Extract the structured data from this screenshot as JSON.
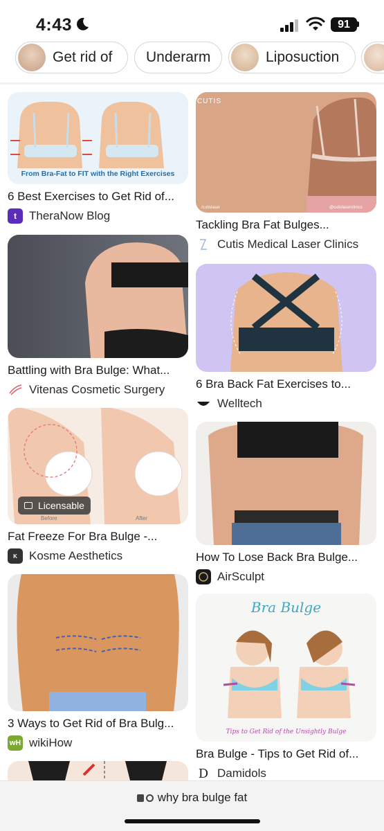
{
  "status": {
    "time": "4:43",
    "battery": "91"
  },
  "chips": [
    {
      "label": "Get rid of",
      "thumb": true
    },
    {
      "label": "Underarm",
      "thumb": false
    },
    {
      "label": "Liposuction",
      "thumb": true
    },
    {
      "label": "",
      "thumb": true
    }
  ],
  "left": [
    {
      "title": "6 Best Exercises to Get Rid of...",
      "source": "TheraNow Blog",
      "favicon": "t",
      "favicon_color": "#5b2db8",
      "img_caption": "From Bra-Fat to FIT with the Right Exercises"
    },
    {
      "title": "Battling with Bra Bulge: What...",
      "source": "Vitenas Cosmetic Surgery",
      "favicon": "",
      "favicon_color": "#ffffff"
    },
    {
      "title": "Fat Freeze For Bra Bulge -...",
      "source": "Kosme Aesthetics",
      "favicon": "K",
      "favicon_color": "#333333",
      "badge": "Licensable",
      "before_label": "Before",
      "after_label": "After"
    },
    {
      "title": "3 Ways to Get Rid of Bra Bulg...",
      "source": "wikiHow",
      "favicon": "wH",
      "favicon_color": "#7ba832"
    },
    {
      "title": "",
      "source": ""
    }
  ],
  "right": [
    {
      "title": "Tackling Bra Fat Bulges...",
      "source": "Cutis Medical Laser Clinics",
      "favicon": "",
      "favicon_color": "#ffffff",
      "img_brand": "CUTIS",
      "img_handle_left": "/cutislaser",
      "img_handle_right": "@cutislaserclinics"
    },
    {
      "title": "6 Bra Back Fat Exercises to...",
      "source": "Welltech",
      "favicon": "",
      "favicon_color": "#ffffff"
    },
    {
      "title": "How To Lose Back Bra Bulge...",
      "source": "AirSculpt",
      "favicon": "",
      "favicon_color": "#1a1a1a"
    },
    {
      "title": "Bra Bulge - Tips to Get Rid of...",
      "source": "Damidols",
      "favicon": "D",
      "favicon_color": "#ffffff",
      "img_title": "Bra Bulge",
      "img_caption": "Tips to Get Rid of the Unsightly Bulge"
    }
  ],
  "urlbar": {
    "query": "why bra bulge fat"
  }
}
